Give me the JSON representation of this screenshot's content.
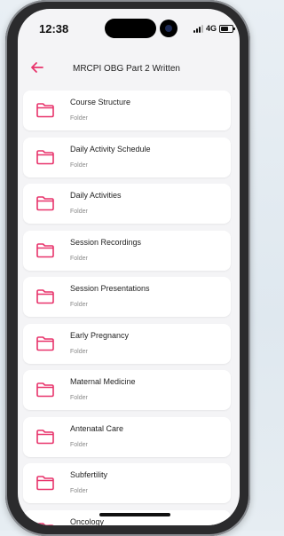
{
  "status_bar": {
    "time": "12:38",
    "network": "4G",
    "signal-icon": "signal-bars-icon",
    "battery-icon": "battery-icon"
  },
  "app_bar": {
    "title": "MRCPI OBG Part 2 Written",
    "back_icon": "back-arrow-icon"
  },
  "colors": {
    "accent": "#e8336b",
    "card": "#ffffff",
    "background": "#f4f4f6"
  },
  "items": [
    {
      "name": "Course Structure",
      "type": "Folder",
      "icon": "folder-icon"
    },
    {
      "name": "Daily Activity Schedule",
      "type": "Folder",
      "icon": "folder-icon"
    },
    {
      "name": "Daily Activities",
      "type": "Folder",
      "icon": "folder-icon"
    },
    {
      "name": "Session Recordings",
      "type": "Folder",
      "icon": "folder-icon"
    },
    {
      "name": "Session Presentations",
      "type": "Folder",
      "icon": "folder-icon"
    },
    {
      "name": "Early Pregnancy",
      "type": "Folder",
      "icon": "folder-icon"
    },
    {
      "name": "Maternal Medicine",
      "type": "Folder",
      "icon": "folder-icon"
    },
    {
      "name": "Antenatal Care",
      "type": "Folder",
      "icon": "folder-icon"
    },
    {
      "name": "Subfertility",
      "type": "Folder",
      "icon": "folder-icon"
    },
    {
      "name": "Oncology",
      "type": "",
      "icon": "folder-icon"
    }
  ]
}
